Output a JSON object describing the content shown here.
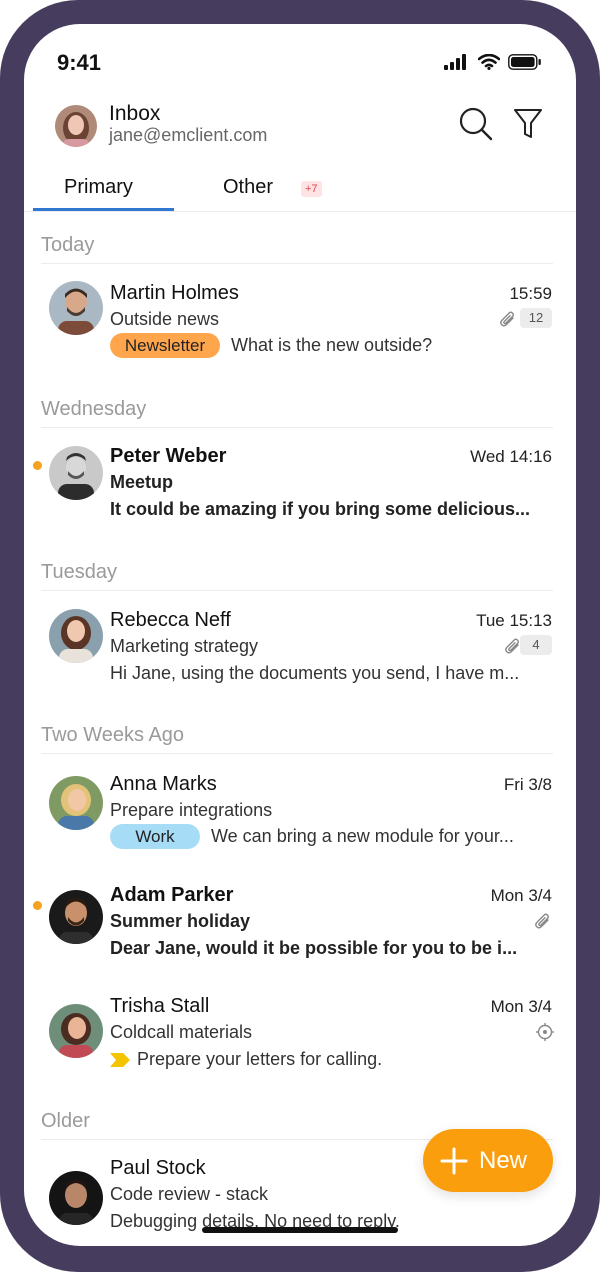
{
  "status_bar": {
    "time": "9:41"
  },
  "header": {
    "title": "Inbox",
    "account": "jane@emclient.com"
  },
  "tabs": [
    {
      "label": "Primary",
      "active": true
    },
    {
      "label": "Other",
      "badge": "+7"
    }
  ],
  "sections": [
    {
      "label": "Today"
    },
    {
      "label": "Wednesday"
    },
    {
      "label": "Tuesday"
    },
    {
      "label": "Two Weeks Ago"
    },
    {
      "label": "Older"
    }
  ],
  "emails": [
    {
      "sender": "Martin Holmes",
      "subject": "Outside news",
      "tag": "Newsletter",
      "preview": "What is the new outside?",
      "time": "15:59",
      "attachment_count": "12",
      "unread": false
    },
    {
      "sender": "Peter Weber",
      "subject": "Meetup",
      "preview": "It could be amazing if you bring some delicious...",
      "time": "Wed 14:16",
      "unread": true
    },
    {
      "sender": "Rebecca Neff",
      "subject": "Marketing strategy",
      "preview": "Hi Jane, using the documents you send, I have m...",
      "time": "Tue 15:13",
      "attachment_count": "4",
      "unread": false
    },
    {
      "sender": "Anna Marks",
      "subject": "Prepare integrations",
      "tag": "Work",
      "preview": "We can bring a new module for your...",
      "time": "Fri 3/8",
      "unread": false
    },
    {
      "sender": "Adam Parker",
      "subject": "Summer holiday",
      "preview": "Dear Jane, would it be possible for you to be i...",
      "time": "Mon 3/4",
      "unread": true
    },
    {
      "sender": "Trisha Stall",
      "subject": "Coldcall materials",
      "preview": "Prepare your letters for calling.",
      "time": "Mon 3/4",
      "unread": false
    },
    {
      "sender": "Paul Stock",
      "subject": "Code review - stack",
      "preview": "Debugging details. No need to reply.",
      "unread": false
    }
  ],
  "fab": {
    "label": "New"
  },
  "colors": {
    "frame": "#463d5e",
    "accent_tab": "#2f77d0",
    "unread_dot": "#f6a21e",
    "fab": "#fb9e0e",
    "tag_newsletter": "#ffa64d",
    "tag_work": "#a7dcf7",
    "tag_followup": "#f5c400"
  },
  "icons": {
    "search": "search-icon",
    "filter": "filter-icon",
    "attachment": "paperclip-icon",
    "reminder": "target-icon",
    "followup": "flag-arrow-icon",
    "new": "plus-icon"
  }
}
